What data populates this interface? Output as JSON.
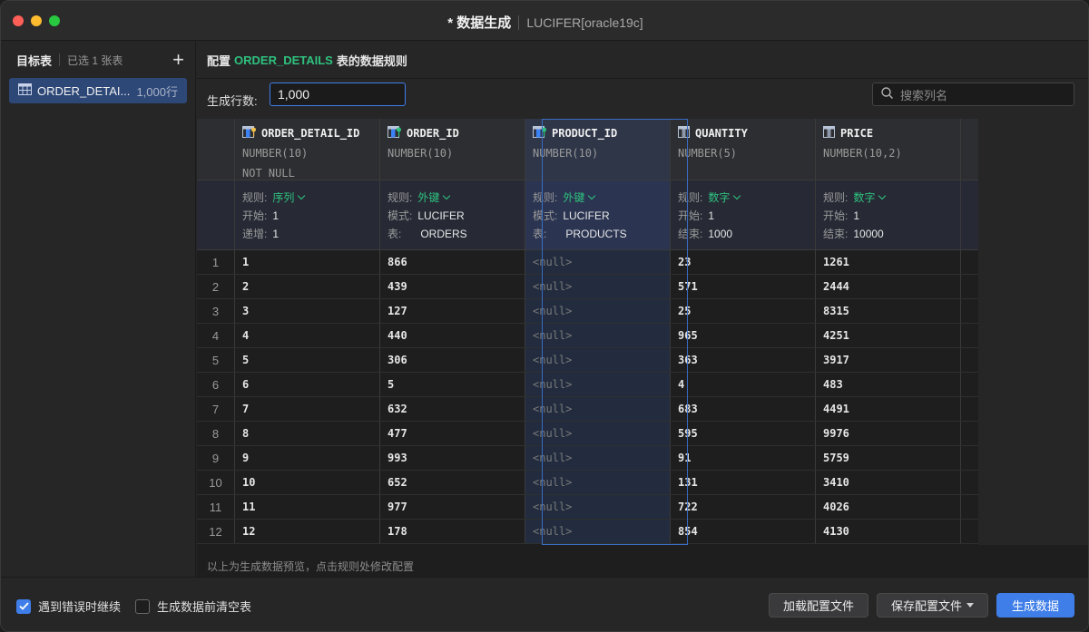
{
  "window": {
    "title": "* 数据生成",
    "connection": "LUCIFER[oracle19c]"
  },
  "sidebar": {
    "title": "目标表",
    "selected_count": "已选 1 张表",
    "items": [
      {
        "name": "ORDER_DETAI...",
        "rows": "1,000行"
      }
    ]
  },
  "config": {
    "prefix": "配置",
    "table": "ORDER_DETAILS",
    "suffix": "表的数据规则"
  },
  "rowcount": {
    "label": "生成行数:",
    "value": "1,000"
  },
  "search": {
    "placeholder": "搜索列名"
  },
  "columns": [
    {
      "name": "ORDER_DETAIL_ID",
      "type": "NUMBER(10)",
      "constraint": "NOT NULL",
      "icon": "key-column-icon",
      "rule": [
        {
          "k": "规则:",
          "v": "序列",
          "dropdown": true
        },
        {
          "k": "开始:",
          "v": "1"
        },
        {
          "k": "递增:",
          "v": "1"
        }
      ]
    },
    {
      "name": "ORDER_ID",
      "type": "NUMBER(10)",
      "constraint": "",
      "icon": "foreign-key-column-icon",
      "rule": [
        {
          "k": "规则:",
          "v": "外键",
          "dropdown": true
        },
        {
          "k": "模式:",
          "v": "LUCIFER"
        },
        {
          "k": "表:",
          "v": "ORDERS"
        }
      ]
    },
    {
      "name": "PRODUCT_ID",
      "type": "NUMBER(10)",
      "constraint": "",
      "icon": "foreign-key-column-icon",
      "rule": [
        {
          "k": "规则:",
          "v": "外键",
          "dropdown": true
        },
        {
          "k": "模式:",
          "v": "LUCIFER"
        },
        {
          "k": "表:",
          "v": "PRODUCTS"
        }
      ]
    },
    {
      "name": "QUANTITY",
      "type": "NUMBER(5)",
      "constraint": "",
      "icon": "column-icon",
      "rule": [
        {
          "k": "规则:",
          "v": "数字",
          "dropdown": true
        },
        {
          "k": "开始:",
          "v": "1"
        },
        {
          "k": "结束:",
          "v": "1000"
        }
      ]
    },
    {
      "name": "PRICE",
      "type": "NUMBER(10,2)",
      "constraint": "",
      "icon": "column-icon",
      "rule": [
        {
          "k": "规则:",
          "v": "数字",
          "dropdown": true
        },
        {
          "k": "开始:",
          "v": "1"
        },
        {
          "k": "结束:",
          "v": "10000"
        }
      ]
    }
  ],
  "rows": [
    [
      "1",
      "1",
      "866",
      "<null>",
      "23",
      "1261"
    ],
    [
      "2",
      "2",
      "439",
      "<null>",
      "571",
      "2444"
    ],
    [
      "3",
      "3",
      "127",
      "<null>",
      "25",
      "8315"
    ],
    [
      "4",
      "4",
      "440",
      "<null>",
      "965",
      "4251"
    ],
    [
      "5",
      "5",
      "306",
      "<null>",
      "363",
      "3917"
    ],
    [
      "6",
      "6",
      "5",
      "<null>",
      "4",
      "483"
    ],
    [
      "7",
      "7",
      "632",
      "<null>",
      "683",
      "4491"
    ],
    [
      "8",
      "8",
      "477",
      "<null>",
      "595",
      "9976"
    ],
    [
      "9",
      "9",
      "993",
      "<null>",
      "91",
      "5759"
    ],
    [
      "10",
      "10",
      "652",
      "<null>",
      "131",
      "3410"
    ],
    [
      "11",
      "11",
      "977",
      "<null>",
      "722",
      "4026"
    ],
    [
      "12",
      "12",
      "178",
      "<null>",
      "854",
      "4130"
    ]
  ],
  "footnote": "以上为生成数据预览，点击规则处修改配置",
  "options": {
    "continue_on_error": "遇到错误时继续",
    "continue_checked": true,
    "truncate_before": "生成数据前清空表",
    "truncate_checked": false
  },
  "buttons": {
    "load": "加载配置文件",
    "save": "保存配置文件",
    "generate": "生成数据"
  },
  "colors": {
    "accent": "#3f7ee8",
    "rule_green": "#2ec27e",
    "selection": "#2d4777"
  }
}
